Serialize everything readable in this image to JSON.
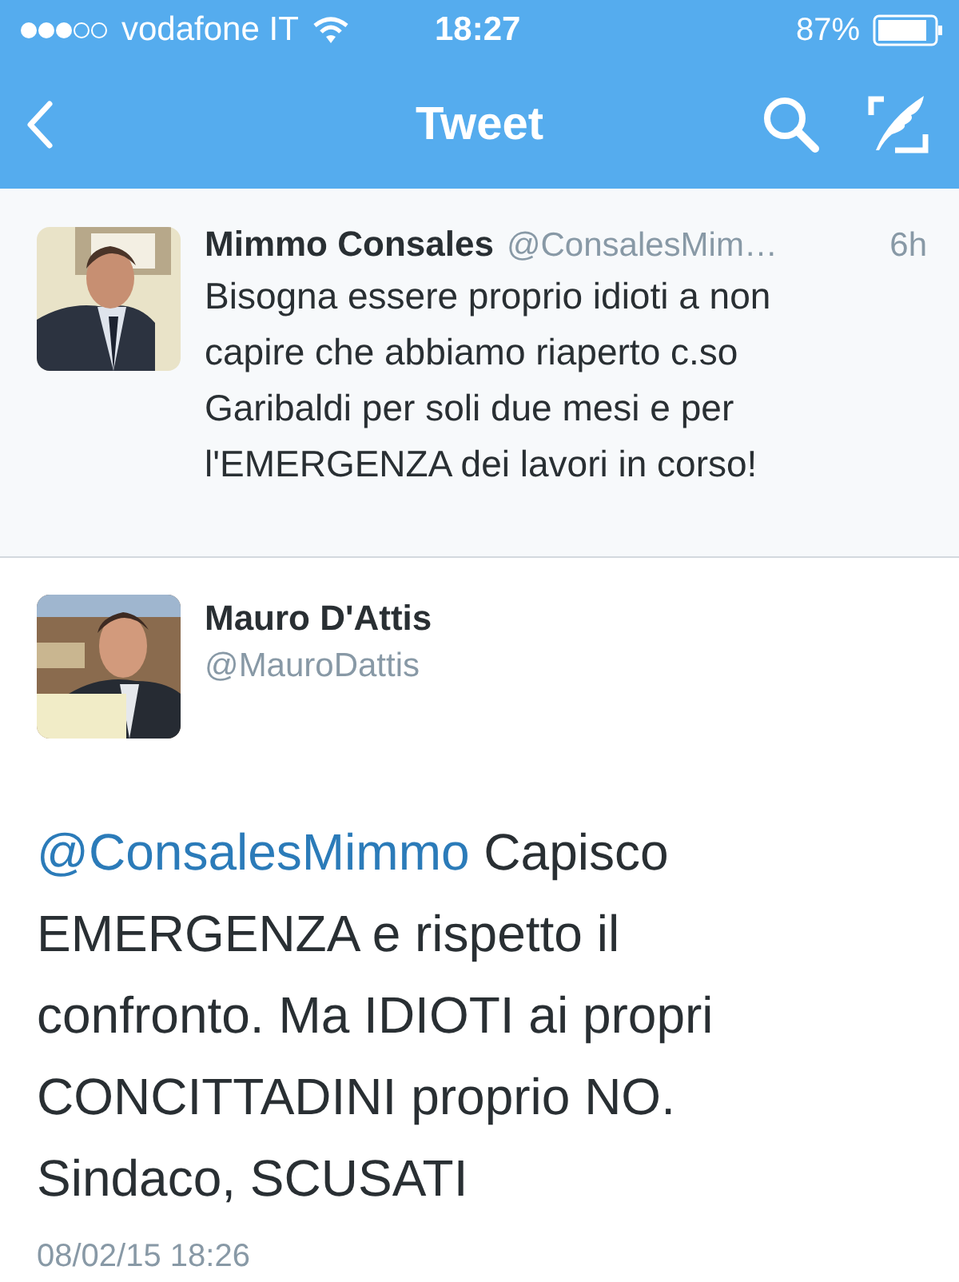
{
  "status_bar": {
    "carrier": "vodafone IT",
    "time": "18:27",
    "battery": "87%"
  },
  "nav": {
    "title": "Tweet"
  },
  "parent_tweet": {
    "name": "Mimmo Consales",
    "handle": "@ConsalesMim…",
    "age": "6h",
    "text": "Bisogna essere proprio idioti a non capire che abbiamo riaperto c.so Garibaldi per soli due mesi e per l'EMERGENZA dei lavori in corso!"
  },
  "tweet": {
    "name": "Mauro D'Attis",
    "handle": "@MauroDattis",
    "mention": "@ConsalesMimmo",
    "text": "Capisco EMERGENZA e rispetto il confronto. Ma IDIOTI ai propri CONCITTADINI proprio NO. Sindaco, SCUSATI",
    "date": "08/02/15 18:26"
  }
}
